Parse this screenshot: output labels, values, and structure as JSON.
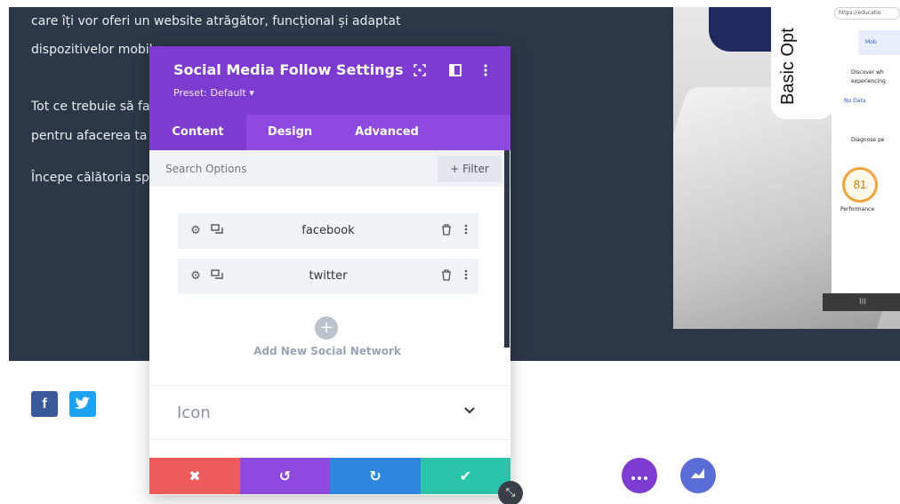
{
  "hero": {
    "lines": [
      "care îți vor oferi un website atrăgător, funcțional și adaptat",
      "dispozitivelor mobile.",
      "Tot ce trebuie să faci",
      "pentru afacerea ta",
      "Începe călătoria spre"
    ]
  },
  "screenshot_panel": {
    "vertical_title": "Basic Opt",
    "url": "https://educatio",
    "mobile_label": "Mob",
    "discover_text": "Discover wh",
    "experiencing_text": "experiencing",
    "no_data": "No Data",
    "diagnose": "Diagnose pe",
    "score": "81",
    "score_label": "Performance",
    "bottom_bar": "III"
  },
  "social": {
    "facebook_glyph": "f",
    "twitter_glyph": "t"
  },
  "modal": {
    "title": "Social Media Follow Settings",
    "preset": "Preset: Default ▾",
    "tabs": [
      "Content",
      "Design",
      "Advanced"
    ],
    "active_tab": "Content",
    "search_placeholder": "Search Options",
    "filter_label": "+ Filter",
    "networks": [
      "facebook",
      "twitter"
    ],
    "add_label": "Add New Social Network",
    "section_title": "Icon"
  },
  "footer": {
    "cancel": "✖",
    "undo": "↺",
    "redo": "↻",
    "save": "✔"
  },
  "colors": {
    "accent": "#7e3bd0",
    "hero_bg": "#2c3748",
    "cancel": "#ef5a5a",
    "undo": "#8e49e0",
    "redo": "#2e86de",
    "save": "#29c4a9"
  }
}
